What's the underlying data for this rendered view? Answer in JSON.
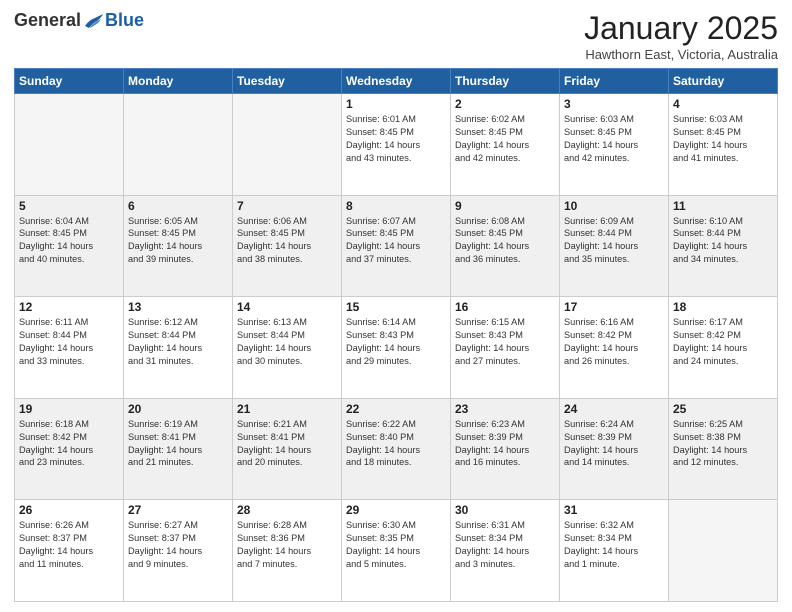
{
  "header": {
    "logo_general": "General",
    "logo_blue": "Blue",
    "month_title": "January 2025",
    "subtitle": "Hawthorn East, Victoria, Australia"
  },
  "days_of_week": [
    "Sunday",
    "Monday",
    "Tuesday",
    "Wednesday",
    "Thursday",
    "Friday",
    "Saturday"
  ],
  "weeks": [
    {
      "shade": false,
      "days": [
        {
          "num": "",
          "info": ""
        },
        {
          "num": "",
          "info": ""
        },
        {
          "num": "",
          "info": ""
        },
        {
          "num": "1",
          "info": "Sunrise: 6:01 AM\nSunset: 8:45 PM\nDaylight: 14 hours\nand 43 minutes."
        },
        {
          "num": "2",
          "info": "Sunrise: 6:02 AM\nSunset: 8:45 PM\nDaylight: 14 hours\nand 42 minutes."
        },
        {
          "num": "3",
          "info": "Sunrise: 6:03 AM\nSunset: 8:45 PM\nDaylight: 14 hours\nand 42 minutes."
        },
        {
          "num": "4",
          "info": "Sunrise: 6:03 AM\nSunset: 8:45 PM\nDaylight: 14 hours\nand 41 minutes."
        }
      ]
    },
    {
      "shade": true,
      "days": [
        {
          "num": "5",
          "info": "Sunrise: 6:04 AM\nSunset: 8:45 PM\nDaylight: 14 hours\nand 40 minutes."
        },
        {
          "num": "6",
          "info": "Sunrise: 6:05 AM\nSunset: 8:45 PM\nDaylight: 14 hours\nand 39 minutes."
        },
        {
          "num": "7",
          "info": "Sunrise: 6:06 AM\nSunset: 8:45 PM\nDaylight: 14 hours\nand 38 minutes."
        },
        {
          "num": "8",
          "info": "Sunrise: 6:07 AM\nSunset: 8:45 PM\nDaylight: 14 hours\nand 37 minutes."
        },
        {
          "num": "9",
          "info": "Sunrise: 6:08 AM\nSunset: 8:45 PM\nDaylight: 14 hours\nand 36 minutes."
        },
        {
          "num": "10",
          "info": "Sunrise: 6:09 AM\nSunset: 8:44 PM\nDaylight: 14 hours\nand 35 minutes."
        },
        {
          "num": "11",
          "info": "Sunrise: 6:10 AM\nSunset: 8:44 PM\nDaylight: 14 hours\nand 34 minutes."
        }
      ]
    },
    {
      "shade": false,
      "days": [
        {
          "num": "12",
          "info": "Sunrise: 6:11 AM\nSunset: 8:44 PM\nDaylight: 14 hours\nand 33 minutes."
        },
        {
          "num": "13",
          "info": "Sunrise: 6:12 AM\nSunset: 8:44 PM\nDaylight: 14 hours\nand 31 minutes."
        },
        {
          "num": "14",
          "info": "Sunrise: 6:13 AM\nSunset: 8:44 PM\nDaylight: 14 hours\nand 30 minutes."
        },
        {
          "num": "15",
          "info": "Sunrise: 6:14 AM\nSunset: 8:43 PM\nDaylight: 14 hours\nand 29 minutes."
        },
        {
          "num": "16",
          "info": "Sunrise: 6:15 AM\nSunset: 8:43 PM\nDaylight: 14 hours\nand 27 minutes."
        },
        {
          "num": "17",
          "info": "Sunrise: 6:16 AM\nSunset: 8:42 PM\nDaylight: 14 hours\nand 26 minutes."
        },
        {
          "num": "18",
          "info": "Sunrise: 6:17 AM\nSunset: 8:42 PM\nDaylight: 14 hours\nand 24 minutes."
        }
      ]
    },
    {
      "shade": true,
      "days": [
        {
          "num": "19",
          "info": "Sunrise: 6:18 AM\nSunset: 8:42 PM\nDaylight: 14 hours\nand 23 minutes."
        },
        {
          "num": "20",
          "info": "Sunrise: 6:19 AM\nSunset: 8:41 PM\nDaylight: 14 hours\nand 21 minutes."
        },
        {
          "num": "21",
          "info": "Sunrise: 6:21 AM\nSunset: 8:41 PM\nDaylight: 14 hours\nand 20 minutes."
        },
        {
          "num": "22",
          "info": "Sunrise: 6:22 AM\nSunset: 8:40 PM\nDaylight: 14 hours\nand 18 minutes."
        },
        {
          "num": "23",
          "info": "Sunrise: 6:23 AM\nSunset: 8:39 PM\nDaylight: 14 hours\nand 16 minutes."
        },
        {
          "num": "24",
          "info": "Sunrise: 6:24 AM\nSunset: 8:39 PM\nDaylight: 14 hours\nand 14 minutes."
        },
        {
          "num": "25",
          "info": "Sunrise: 6:25 AM\nSunset: 8:38 PM\nDaylight: 14 hours\nand 12 minutes."
        }
      ]
    },
    {
      "shade": false,
      "days": [
        {
          "num": "26",
          "info": "Sunrise: 6:26 AM\nSunset: 8:37 PM\nDaylight: 14 hours\nand 11 minutes."
        },
        {
          "num": "27",
          "info": "Sunrise: 6:27 AM\nSunset: 8:37 PM\nDaylight: 14 hours\nand 9 minutes."
        },
        {
          "num": "28",
          "info": "Sunrise: 6:28 AM\nSunset: 8:36 PM\nDaylight: 14 hours\nand 7 minutes."
        },
        {
          "num": "29",
          "info": "Sunrise: 6:30 AM\nSunset: 8:35 PM\nDaylight: 14 hours\nand 5 minutes."
        },
        {
          "num": "30",
          "info": "Sunrise: 6:31 AM\nSunset: 8:34 PM\nDaylight: 14 hours\nand 3 minutes."
        },
        {
          "num": "31",
          "info": "Sunrise: 6:32 AM\nSunset: 8:34 PM\nDaylight: 14 hours\nand 1 minute."
        },
        {
          "num": "",
          "info": ""
        }
      ]
    }
  ]
}
